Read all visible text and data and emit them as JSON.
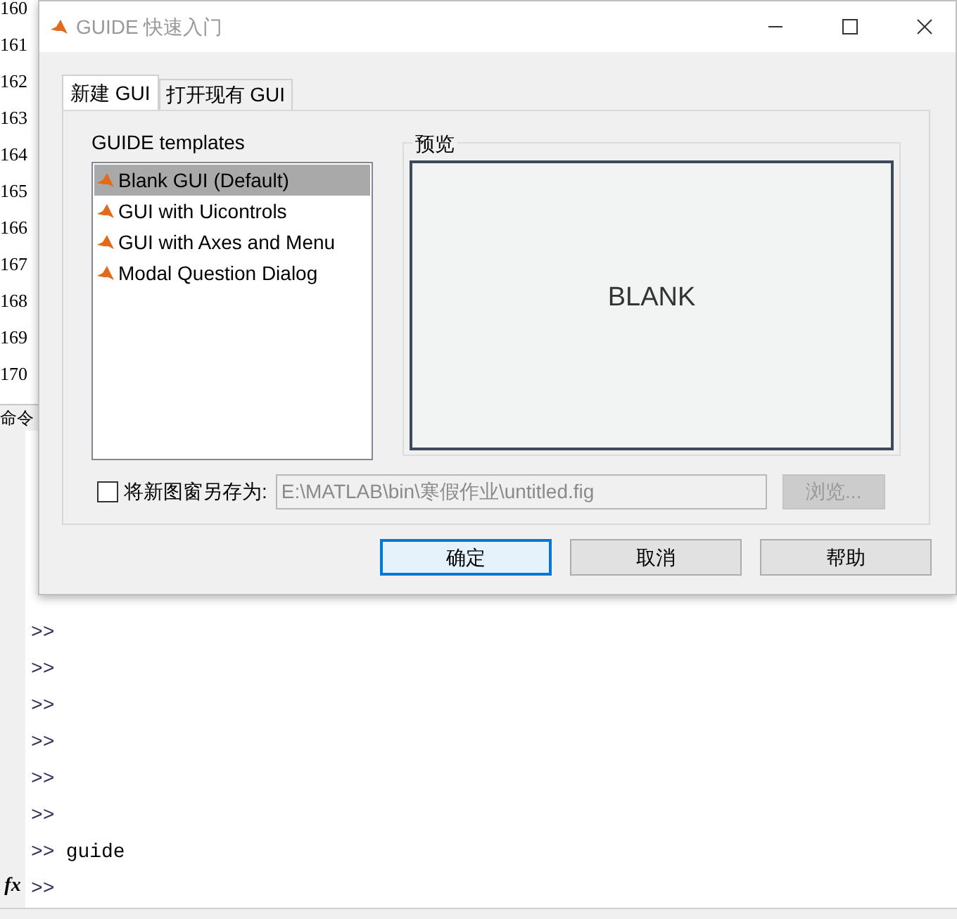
{
  "editor": {
    "line_numbers": [
      "160",
      "161",
      "162",
      "163",
      "164",
      "165",
      "166",
      "167",
      "168",
      "169",
      "170"
    ]
  },
  "command_window": {
    "title": "命令",
    "function_button": "fx",
    "lines": [
      {
        "prompt": ">>"
      },
      {
        "prompt": ">>"
      },
      {
        "prompt": ">>"
      },
      {
        "prompt": ">>"
      },
      {
        "prompt": ">>"
      },
      {
        "prompt": ">>"
      },
      {
        "prompt": ">>",
        "command": "guide"
      },
      {
        "prompt": ">>"
      }
    ]
  },
  "dialog": {
    "title": "GUIDE 快速入门",
    "tabs": [
      {
        "label": "新建 GUI",
        "selected": true
      },
      {
        "label": "打开现有 GUI",
        "selected": false
      }
    ],
    "templates_label": "GUIDE templates",
    "templates": [
      {
        "label": "Blank GUI (Default)",
        "selected": true
      },
      {
        "label": "GUI with Uicontrols",
        "selected": false
      },
      {
        "label": "GUI with Axes and Menu",
        "selected": false
      },
      {
        "label": "Modal Question Dialog",
        "selected": false
      }
    ],
    "preview": {
      "title": "预览",
      "content": "BLANK"
    },
    "save_as": {
      "checked": false,
      "label": "将新图窗另存为:",
      "value": "E:\\MATLAB\\bin\\寒假作业\\untitled.fig",
      "browse_button": {
        "label": "浏览...",
        "disabled": true
      }
    },
    "buttons": [
      {
        "label": "确定",
        "focused": true
      },
      {
        "label": "取消",
        "focused": false
      },
      {
        "label": "帮助",
        "focused": false
      }
    ]
  }
}
